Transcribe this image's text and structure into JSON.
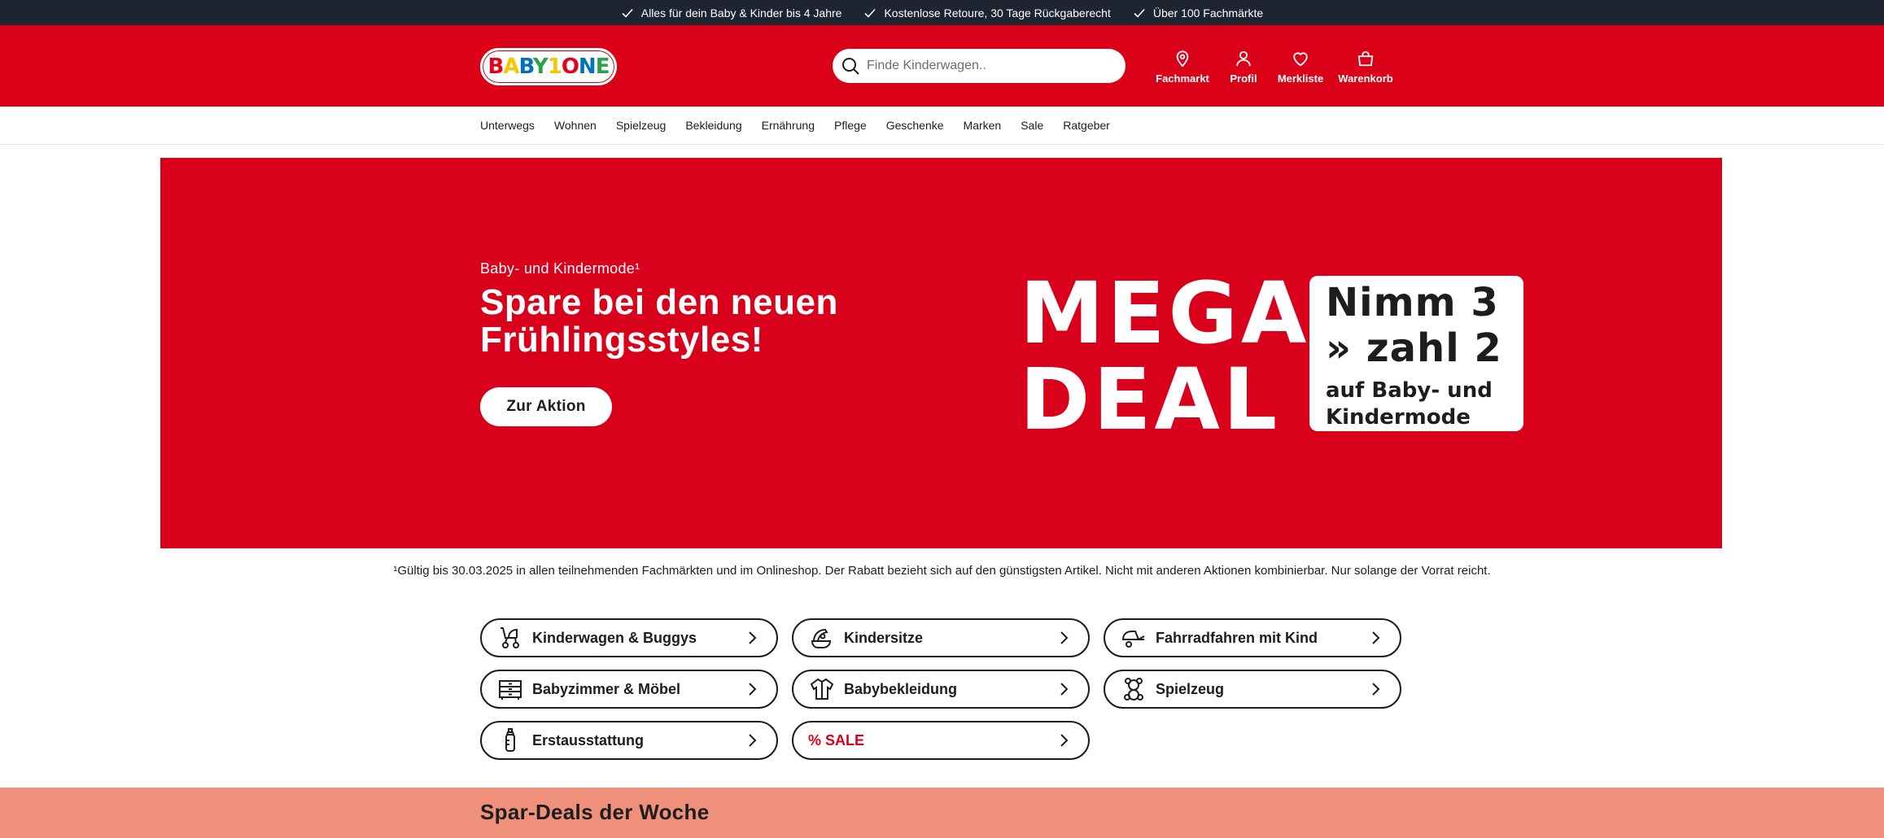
{
  "topbar": {
    "usps": [
      {
        "text": "Alles für dein Baby & Kinder bis 4 Jahre",
        "icon": "check-icon"
      },
      {
        "text": "Kostenlose Retoure, 30 Tage Rückgaberecht",
        "icon": "check-icon"
      },
      {
        "text": "Über 100 Fachmärkte",
        "icon": "check-icon"
      }
    ]
  },
  "header": {
    "logo_text": "BABY1ONE",
    "search_placeholder": "Finde Kinderwagen..",
    "icons": {
      "fachmarkt": "Fachmarkt",
      "profil": "Profil",
      "merkliste": "Merkliste",
      "warenkorb": "Warenkorb"
    }
  },
  "nav": {
    "items": [
      "Unterwegs",
      "Wohnen",
      "Spielzeug",
      "Bekleidung",
      "Ernährung",
      "Pflege",
      "Geschenke",
      "Marken",
      "Sale",
      "Ratgeber"
    ]
  },
  "hero": {
    "kicker": "Baby- und Kindermode¹",
    "headline": "Spare bei den neuen Frühlingsstyles!",
    "cta": "Zur Aktion",
    "mega_line1": "MEGA",
    "mega_line2": "DEAL",
    "deal_line1": "Nimm 3",
    "deal_line2": "» zahl 2",
    "deal_line3": "auf Baby- und",
    "deal_line4": "Kindermode"
  },
  "footnote": "¹Gültig bis 30.03.2025 in allen teilnehmenden Fachmärkten und im Onlineshop. Der Rabatt bezieht sich auf den günstigsten Artikel. Nicht mit anderen Aktionen kombinierbar. Nur solange der Vorrat reicht.",
  "categories": [
    {
      "label": "Kinderwagen & Buggys",
      "icon": "stroller-icon"
    },
    {
      "label": "Kindersitze",
      "icon": "car-seat-icon"
    },
    {
      "label": "Fahrradfahren mit Kind",
      "icon": "bike-trailer-icon"
    },
    {
      "label": "Babyzimmer & Möbel",
      "icon": "dresser-icon"
    },
    {
      "label": "Babybekleidung",
      "icon": "jacket-icon"
    },
    {
      "label": "Spielzeug",
      "icon": "teddy-bear-icon"
    },
    {
      "label": "Erstausstattung",
      "icon": "baby-bottle-icon"
    },
    {
      "label": "% SALE",
      "icon": ""
    }
  ],
  "deals_section": {
    "title": "Spar-Deals der Woche"
  },
  "colors": {
    "brand_red": "#d90018",
    "topbar_dark": "#1f2530",
    "deals_bg": "#ef907a"
  }
}
